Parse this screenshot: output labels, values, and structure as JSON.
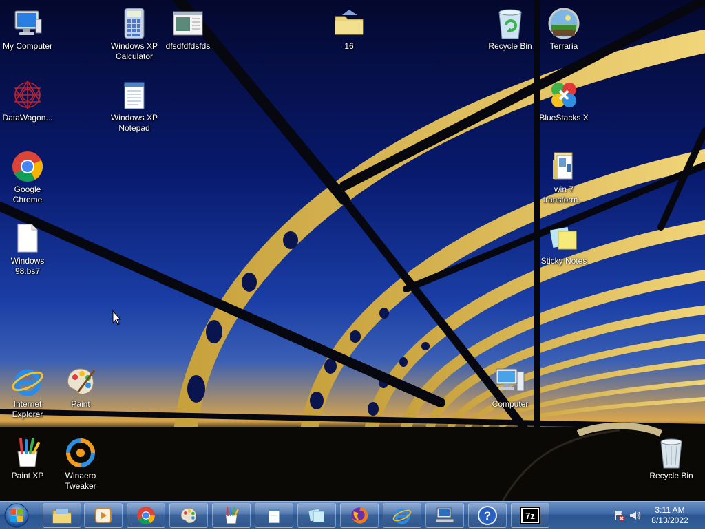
{
  "desktop": {
    "icons": {
      "my_computer": "My Computer",
      "xp_calculator": "Windows XP Calculator",
      "dfsd": "dfsdfdfdsfds",
      "folder16": "16",
      "recycle_top": "Recycle Bin",
      "terraria": "Terraria",
      "datawagon": "DataWagon...",
      "xp_notepad": "Windows XP Notepad",
      "bluestacks": "BlueStacks X",
      "chrome": "Google Chrome",
      "win7transform": "win 7 transform...",
      "win98": "Windows 98.bs7",
      "sticky": "Sticky Notes",
      "ie": "Internet Explorer",
      "paint": "Paint",
      "computer": "Computer",
      "paintxp": "Paint XP",
      "winaero": "Winaero Tweaker",
      "recycle_bottom": "Recycle Bin"
    }
  },
  "taskbar": {
    "pinned": [
      "windows-explorer-icon",
      "media-player-icon",
      "chrome-icon",
      "paint-icon",
      "paint-xp-icon",
      "notepad-icon",
      "sticky-notes-icon",
      "firefox-icon",
      "internet-explorer-icon",
      "network-computer-icon",
      "help-icon",
      "7zip-icon"
    ],
    "seven_zip_label": "7z",
    "help_label": "?",
    "clock": {
      "time": "3:11 AM",
      "date": "8/13/2022"
    }
  },
  "colors": {
    "taskbar": "#3e6aa8",
    "sky_top": "#04082e",
    "sky_bottom": "#3a5fb4",
    "sunset": "#d9a54c"
  }
}
